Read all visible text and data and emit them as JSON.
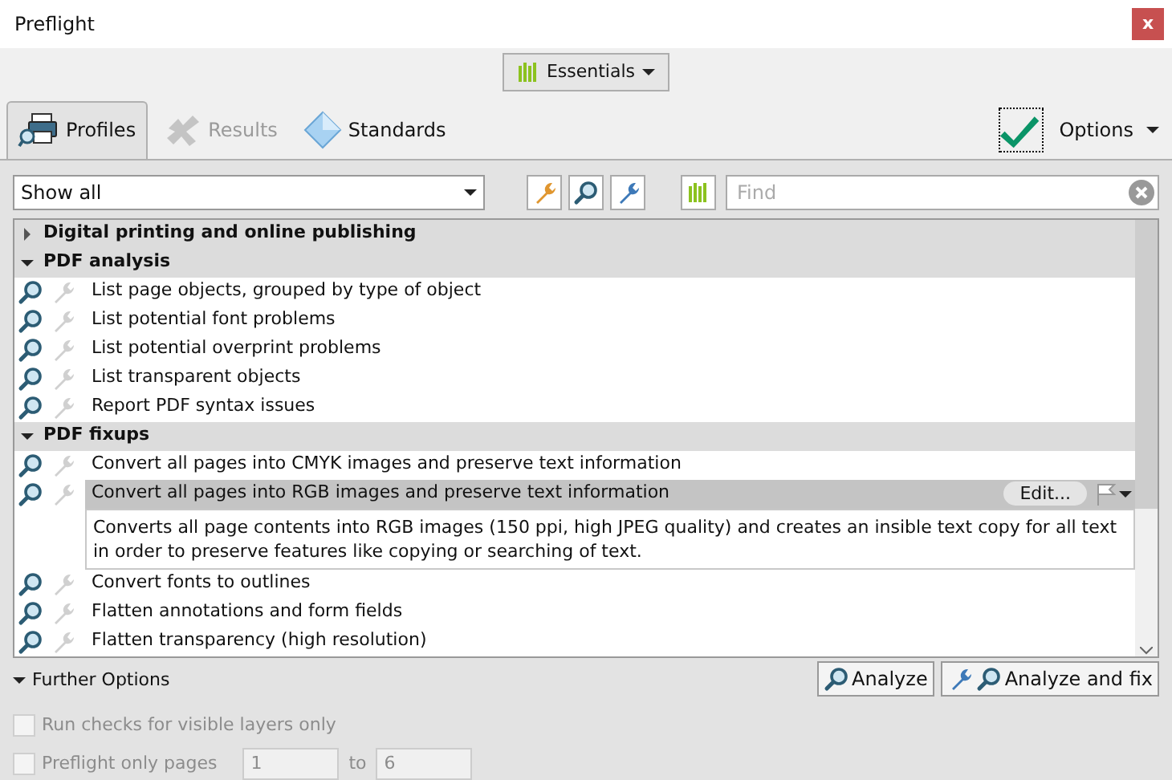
{
  "window": {
    "title": "Preflight",
    "close": "x"
  },
  "mode_button": {
    "label": "Essentials"
  },
  "tabs": [
    {
      "label": "Profiles",
      "selected": true,
      "disabled": false
    },
    {
      "label": "Results",
      "selected": false,
      "disabled": true
    },
    {
      "label": "Standards",
      "selected": false,
      "disabled": false
    }
  ],
  "options": {
    "label": "Options"
  },
  "filter": {
    "value": "Show all"
  },
  "search": {
    "placeholder": "Find"
  },
  "groups": [
    {
      "title": "Digital printing and online publishing",
      "expanded": false
    },
    {
      "title": "PDF analysis",
      "expanded": true,
      "items": [
        {
          "label": "List page objects, grouped by type of object",
          "selected": false
        },
        {
          "label": "List potential font problems",
          "selected": false
        },
        {
          "label": "List potential overprint problems",
          "selected": false
        },
        {
          "label": "List transparent objects",
          "selected": false
        },
        {
          "label": "Report PDF syntax issues",
          "selected": false
        }
      ]
    },
    {
      "title": "PDF fixups",
      "expanded": true,
      "items": [
        {
          "label": "Convert all pages into CMYK images and preserve text information",
          "selected": false
        },
        {
          "label": "Convert all pages into RGB images and preserve text information",
          "selected": true,
          "edit": "Edit...",
          "description": "Converts all page contents into RGB images (150 ppi, high JPEG quality) and creates an insible text copy for all text in order to preserve features like copying or searching of text."
        },
        {
          "label": "Convert fonts to outlines",
          "selected": false
        },
        {
          "label": "Flatten annotations and form fields",
          "selected": false
        },
        {
          "label": "Flatten transparency (high resolution)",
          "selected": false
        }
      ]
    }
  ],
  "further_options": {
    "title": "Further Options",
    "expanded": true
  },
  "actions": [
    {
      "kind": "analyze",
      "label": "Analyze"
    },
    {
      "kind": "fix",
      "label": "Analyze and fix"
    }
  ],
  "checks": [
    {
      "label": "Run checks for visible layers only",
      "checked": false,
      "disabled": true
    },
    {
      "label": "Preflight only pages",
      "checked": false,
      "disabled": true,
      "from": "1",
      "to_label": "to",
      "to": "6"
    }
  ]
}
